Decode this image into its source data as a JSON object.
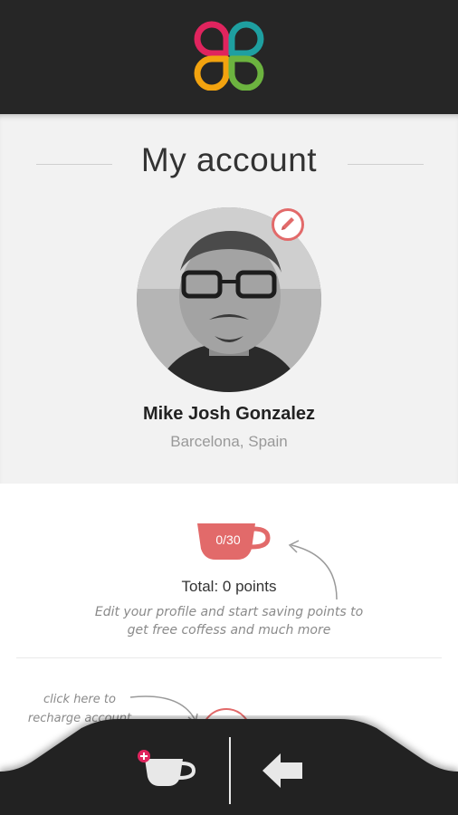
{
  "header": {
    "logo_icon": "four-petal-logo",
    "colors": {
      "bar": "#262626",
      "pink": "#e0245e",
      "teal": "#1e9fa0",
      "orange": "#f2a30f",
      "green": "#6cb33f"
    }
  },
  "profile": {
    "title": "My account",
    "name": "Mike Josh Gonzalez",
    "location": "Barcelona, Spain",
    "edit_icon": "pencil-icon"
  },
  "points": {
    "cup_count": "0/30",
    "total": "Total: 0 points",
    "hint": "Edit your profile and start saving points to get free coffess and much more",
    "recharge_hint": "click here to recharge account",
    "accent": "#e26a6a"
  },
  "bottom_nav": {
    "items": [
      {
        "icon": "add-coffee-cup-icon"
      },
      {
        "icon": "back-arrow-icon"
      }
    ]
  }
}
